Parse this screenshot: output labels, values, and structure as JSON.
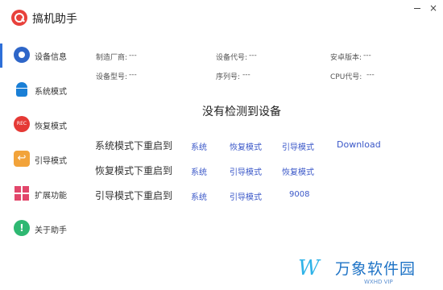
{
  "app": {
    "title": "搞机助手",
    "minimize": "—",
    "close": "×"
  },
  "sidebar": {
    "items": [
      {
        "label": "设备信息",
        "icon": "gear-icon"
      },
      {
        "label": "系统模式",
        "icon": "android-icon"
      },
      {
        "label": "恢复模式",
        "icon": "rec-icon",
        "icon_text": "REC"
      },
      {
        "label": "引导模式",
        "icon": "back-arrow-icon",
        "icon_text": "↩"
      },
      {
        "label": "扩展功能",
        "icon": "grid-icon"
      },
      {
        "label": "关于助手",
        "icon": "info-icon",
        "icon_text": "!"
      }
    ]
  },
  "device": {
    "manufacturer": {
      "label": "制造厂商:",
      "value": "---"
    },
    "code": {
      "label": "设备代号:",
      "value": "---"
    },
    "android": {
      "label": "安卓版本:",
      "value": "---"
    },
    "model": {
      "label": "设备型号:",
      "value": "---"
    },
    "serial": {
      "label": "序列号:",
      "value": "---"
    },
    "cpu": {
      "label": "CPU代号:",
      "value": "---"
    }
  },
  "status": "没有检测到设备",
  "reboot": {
    "rows": [
      {
        "label": "系统模式下重启到",
        "links": [
          "系统",
          "恢复模式",
          "引导模式",
          "Download"
        ]
      },
      {
        "label": "恢复模式下重启到",
        "links": [
          "系统",
          "引导模式",
          "恢复模式"
        ]
      },
      {
        "label": "引导模式下重启到",
        "links": [
          "系统",
          "引导模式",
          "9008"
        ]
      }
    ]
  },
  "watermark": {
    "logo": "W",
    "text": "万象软件园",
    "sub": "WXHD VIP"
  }
}
